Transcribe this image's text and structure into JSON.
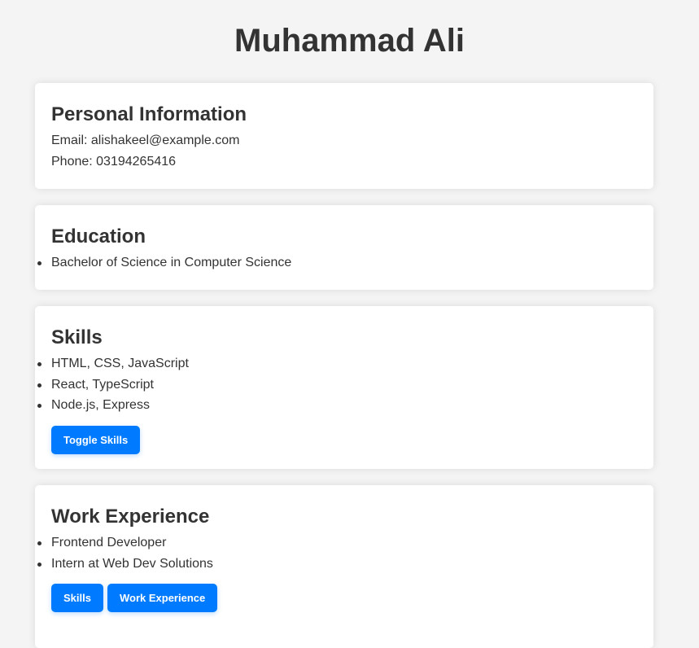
{
  "header": {
    "title": "Muhammad Ali"
  },
  "personal": {
    "heading": "Personal Information",
    "email": "Email: alishakeel@example.com",
    "phone": "Phone: 03194265416"
  },
  "education": {
    "heading": "Education",
    "items": [
      "Bachelor of Science in Computer Science"
    ]
  },
  "skills": {
    "heading": "Skills",
    "items": [
      "HTML, CSS, JavaScript",
      "React, TypeScript",
      "Node.js, Express"
    ],
    "toggle_label": "Toggle Skills"
  },
  "work": {
    "heading": "Work Experience",
    "items": [
      "Frontend Developer",
      "Intern at Web Dev Solutions"
    ],
    "skills_button_label": "Skills",
    "work_button_label": "Work Experience"
  },
  "colors": {
    "background": "#f4f4f4",
    "card": "#ffffff",
    "text": "#333333",
    "accent": "#007bff"
  }
}
